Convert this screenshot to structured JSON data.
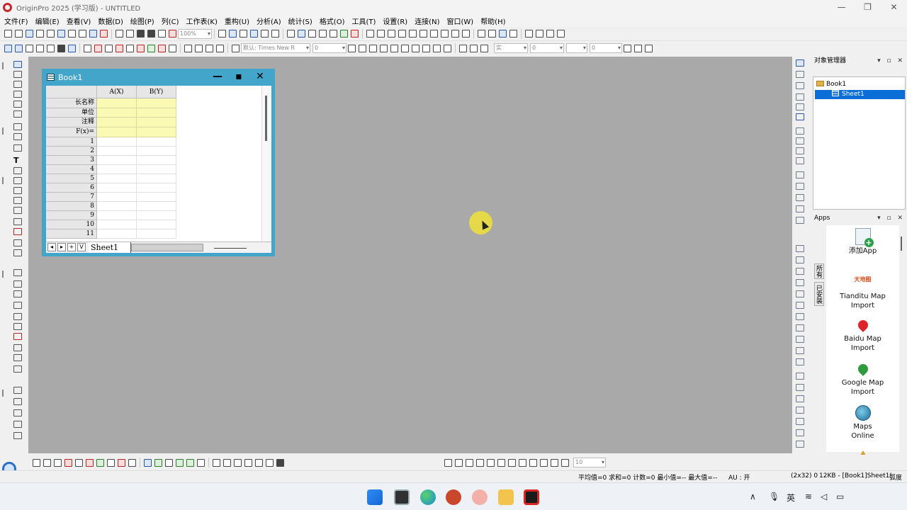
{
  "window": {
    "title": "OriginPro 2025 (学习版) - UNTITLED",
    "min_icon": "minimize-icon",
    "max_icon": "maximize-icon",
    "close_icon": "close-icon"
  },
  "menu": [
    "文件(F)",
    "编辑(E)",
    "查看(V)",
    "数据(D)",
    "绘图(P)",
    "列(C)",
    "工作表(K)",
    "重构(U)",
    "分析(A)",
    "统计(S)",
    "格式(O)",
    "工具(T)",
    "设置(R)",
    "连接(N)",
    "窗口(W)",
    "帮助(H)"
  ],
  "toolbar": {
    "zoom": "100%",
    "font_name": "默认: Times New R",
    "font_size": "0",
    "line_style": "实",
    "line_width": "0",
    "line_width2": "0",
    "bottom_size": "10"
  },
  "book": {
    "title": "Book1",
    "columns": [
      "A(X)",
      "B(Y)"
    ],
    "meta_rows": [
      "长名称",
      "单位",
      "注释",
      "F(x)="
    ],
    "row_numbers": [
      "1",
      "2",
      "3",
      "4",
      "5",
      "6",
      "7",
      "8",
      "9",
      "10",
      "11"
    ],
    "sheet_tab": "Sheet1",
    "nav": [
      "◂",
      "▸",
      "+",
      "V"
    ]
  },
  "object_manager": {
    "title": "对象管理器",
    "items": [
      {
        "label": "Book1",
        "icon": "folder-icon"
      },
      {
        "label": "Sheet1",
        "icon": "sheet-icon"
      }
    ]
  },
  "apps": {
    "title": "Apps",
    "side_tabs": [
      "所有",
      "已安装"
    ],
    "items": [
      {
        "label": "添加App",
        "icon": "add-app-icon"
      },
      {
        "label": "Tianditu Map Import",
        "logo_text": "天地图",
        "icon": "tianditu-icon"
      },
      {
        "label": "Baidu Map Import",
        "icon": "red-pin-icon"
      },
      {
        "label": "Google Map Import",
        "icon": "green-pin-icon"
      },
      {
        "label": "Maps Online",
        "icon": "globe-icon"
      },
      {
        "label": "",
        "icon": "pyramid-icon"
      }
    ]
  },
  "status": {
    "stats": "平均值=0 求和=0 计数=0 最小值=-- 最大值=--",
    "au": "AU : 开",
    "dims": "(2x32) 0",
    "mem": "12KB - [Book1]Sheet1!",
    "angle": "弧度"
  },
  "taskbar": {
    "tray_lang": "英",
    "tray_up": "∧"
  }
}
